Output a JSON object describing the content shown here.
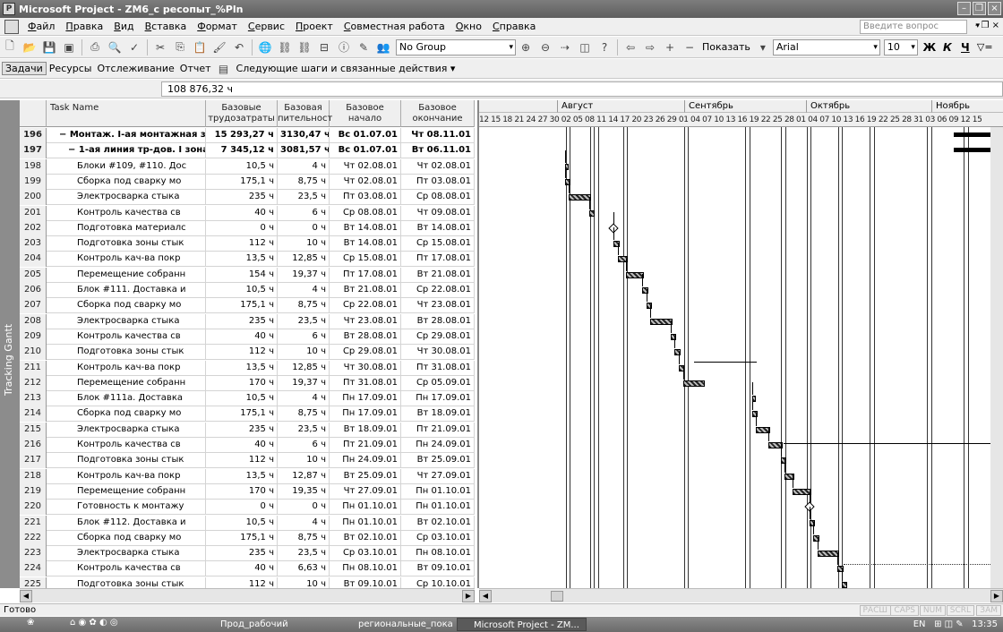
{
  "window": {
    "title": "Microsoft Project - ZM6_c ресопыт_%Pln"
  },
  "menu": [
    "Файл",
    "Правка",
    "Вид",
    "Вставка",
    "Формат",
    "Сервис",
    "Проект",
    "Совместная работа",
    "Окно",
    "Справка"
  ],
  "ask_question": {
    "placeholder": "Введите вопрос"
  },
  "toolbar": {
    "group_combo": "No Group",
    "show_label": "Показать",
    "font_combo": "Arial",
    "size_combo": "10",
    "bold": "Ж",
    "italic": "К",
    "underline": "Ч",
    "filter": "▽="
  },
  "guide": {
    "tasks": "Задачи",
    "resources": "Ресурсы",
    "tracking": "Отслеживание",
    "report": "Отчет",
    "next_steps": "Следующие шаги и связанные действия ▾"
  },
  "entry_value": "108 876,32 ч",
  "view_label": "Tracking Gantt",
  "columns": {
    "task_name": "Task Name",
    "work": "Базовые трудозатраты",
    "duration": "Базовая пительност",
    "start": "Базовое начало",
    "finish": "Базовое окончание"
  },
  "rows": [
    {
      "id": "196",
      "name": "− Монтаж. I-ая монтажная зон",
      "work": "15 293,27 ч",
      "dur": "3130,47 ч",
      "start": "Вс 01.07.01",
      "finish": "Чт 08.11.01",
      "summary": true
    },
    {
      "id": "197",
      "name": "− 1-ая линия тр-дов. I зона",
      "work": "7 345,12 ч",
      "dur": "3081,57 ч",
      "start": "Вс 01.07.01",
      "finish": "Вт 06.11.01",
      "summary": true
    },
    {
      "id": "198",
      "name": "Блоки #109, #110. Дос",
      "work": "10,5 ч",
      "dur": "4 ч",
      "start": "Чт 02.08.01",
      "finish": "Чт 02.08.01"
    },
    {
      "id": "199",
      "name": "Сборка под сварку мо",
      "work": "175,1 ч",
      "dur": "8,75 ч",
      "start": "Чт 02.08.01",
      "finish": "Пт 03.08.01"
    },
    {
      "id": "200",
      "name": "Электросварка стыка",
      "work": "235 ч",
      "dur": "23,5 ч",
      "start": "Пт 03.08.01",
      "finish": "Ср 08.08.01"
    },
    {
      "id": "201",
      "name": "Контроль качества св",
      "work": "40 ч",
      "dur": "6 ч",
      "start": "Ср 08.08.01",
      "finish": "Чт 09.08.01"
    },
    {
      "id": "202",
      "name": "Подготовка материалс",
      "work": "0 ч",
      "dur": "0 ч",
      "start": "Вт 14.08.01",
      "finish": "Вт 14.08.01"
    },
    {
      "id": "203",
      "name": "Подготовка зоны стык",
      "work": "112 ч",
      "dur": "10 ч",
      "start": "Вт 14.08.01",
      "finish": "Ср 15.08.01"
    },
    {
      "id": "204",
      "name": "Контроль кач-ва покр",
      "work": "13,5 ч",
      "dur": "12,85 ч",
      "start": "Ср 15.08.01",
      "finish": "Пт 17.08.01"
    },
    {
      "id": "205",
      "name": "Перемещение собранн",
      "work": "154 ч",
      "dur": "19,37 ч",
      "start": "Пт 17.08.01",
      "finish": "Вт 21.08.01"
    },
    {
      "id": "206",
      "name": "Блок #111. Доставка и",
      "work": "10,5 ч",
      "dur": "4 ч",
      "start": "Вт 21.08.01",
      "finish": "Ср 22.08.01"
    },
    {
      "id": "207",
      "name": "Сборка под сварку мо",
      "work": "175,1 ч",
      "dur": "8,75 ч",
      "start": "Ср 22.08.01",
      "finish": "Чт 23.08.01"
    },
    {
      "id": "208",
      "name": "Электросварка стыка",
      "work": "235 ч",
      "dur": "23,5 ч",
      "start": "Чт 23.08.01",
      "finish": "Вт 28.08.01"
    },
    {
      "id": "209",
      "name": "Контроль качества св",
      "work": "40 ч",
      "dur": "6 ч",
      "start": "Вт 28.08.01",
      "finish": "Ср 29.08.01"
    },
    {
      "id": "210",
      "name": "Подготовка зоны стык",
      "work": "112 ч",
      "dur": "10 ч",
      "start": "Ср 29.08.01",
      "finish": "Чт 30.08.01"
    },
    {
      "id": "211",
      "name": "Контроль кач-ва покр",
      "work": "13,5 ч",
      "dur": "12,85 ч",
      "start": "Чт 30.08.01",
      "finish": "Пт 31.08.01"
    },
    {
      "id": "212",
      "name": "Перемещение собранн",
      "work": "170 ч",
      "dur": "19,37 ч",
      "start": "Пт 31.08.01",
      "finish": "Ср 05.09.01"
    },
    {
      "id": "213",
      "name": "Блок #111a. Доставка",
      "work": "10,5 ч",
      "dur": "4 ч",
      "start": "Пн 17.09.01",
      "finish": "Пн 17.09.01"
    },
    {
      "id": "214",
      "name": "Сборка под сварку мо",
      "work": "175,1 ч",
      "dur": "8,75 ч",
      "start": "Пн 17.09.01",
      "finish": "Вт 18.09.01"
    },
    {
      "id": "215",
      "name": "Электросварка стыка",
      "work": "235 ч",
      "dur": "23,5 ч",
      "start": "Вт 18.09.01",
      "finish": "Пт 21.09.01"
    },
    {
      "id": "216",
      "name": "Контроль качества св",
      "work": "40 ч",
      "dur": "6 ч",
      "start": "Пт 21.09.01",
      "finish": "Пн 24.09.01"
    },
    {
      "id": "217",
      "name": "Подготовка зоны стык",
      "work": "112 ч",
      "dur": "10 ч",
      "start": "Пн 24.09.01",
      "finish": "Вт 25.09.01"
    },
    {
      "id": "218",
      "name": "Контроль кач-ва покр",
      "work": "13,5 ч",
      "dur": "12,87 ч",
      "start": "Вт 25.09.01",
      "finish": "Чт 27.09.01"
    },
    {
      "id": "219",
      "name": "Перемещение собранн",
      "work": "170 ч",
      "dur": "19,35 ч",
      "start": "Чт 27.09.01",
      "finish": "Пн 01.10.01"
    },
    {
      "id": "220",
      "name": "Готовность к монтажу",
      "work": "0 ч",
      "dur": "0 ч",
      "start": "Пн 01.10.01",
      "finish": "Пн 01.10.01"
    },
    {
      "id": "221",
      "name": "Блок #112. Доставка и",
      "work": "10,5 ч",
      "dur": "4 ч",
      "start": "Пн 01.10.01",
      "finish": "Вт 02.10.01"
    },
    {
      "id": "222",
      "name": "Сборка под сварку мо",
      "work": "175,1 ч",
      "dur": "8,75 ч",
      "start": "Вт 02.10.01",
      "finish": "Ср 03.10.01"
    },
    {
      "id": "223",
      "name": "Электросварка стыка",
      "work": "235 ч",
      "dur": "23,5 ч",
      "start": "Ср 03.10.01",
      "finish": "Пн 08.10.01"
    },
    {
      "id": "224",
      "name": "Контроль качества св",
      "work": "40 ч",
      "dur": "6,63 ч",
      "start": "Пн 08.10.01",
      "finish": "Вт 09.10.01"
    },
    {
      "id": "225",
      "name": "Подготовка зоны стык",
      "work": "112 ч",
      "dur": "10 ч",
      "start": "Вт 09.10.01",
      "finish": "Ср 10.10.01"
    },
    {
      "id": "226",
      "name": "Контроль кач-ва покр",
      "work": "13,5 ч",
      "dur": "12,87 ч",
      "start": "Ср 10.10.01",
      "finish": "Чт 11.10.01"
    }
  ],
  "timescale": {
    "months": [
      "Август",
      "Сентябрь",
      "Октябрь",
      "Ноябрь"
    ],
    "days": "12 15 18 21 24 27 30 02 05 08 11 14 17 20 23 26 29 01 04 07 10 13 16 19 22 25 28 01 04 07 10 13 16 19 22 25 28 31 03 06 09 12 15"
  },
  "status": {
    "text": "Готово",
    "indicators": [
      "РАСШ",
      "CAPS",
      "NUM",
      "SCRL",
      "ЗАМ"
    ]
  },
  "taskbar": {
    "items": [
      "Прод_рабочий",
      "региональные_показ...",
      "Microsoft Project - ZM..."
    ],
    "lang": "EN",
    "time": "13:35"
  }
}
